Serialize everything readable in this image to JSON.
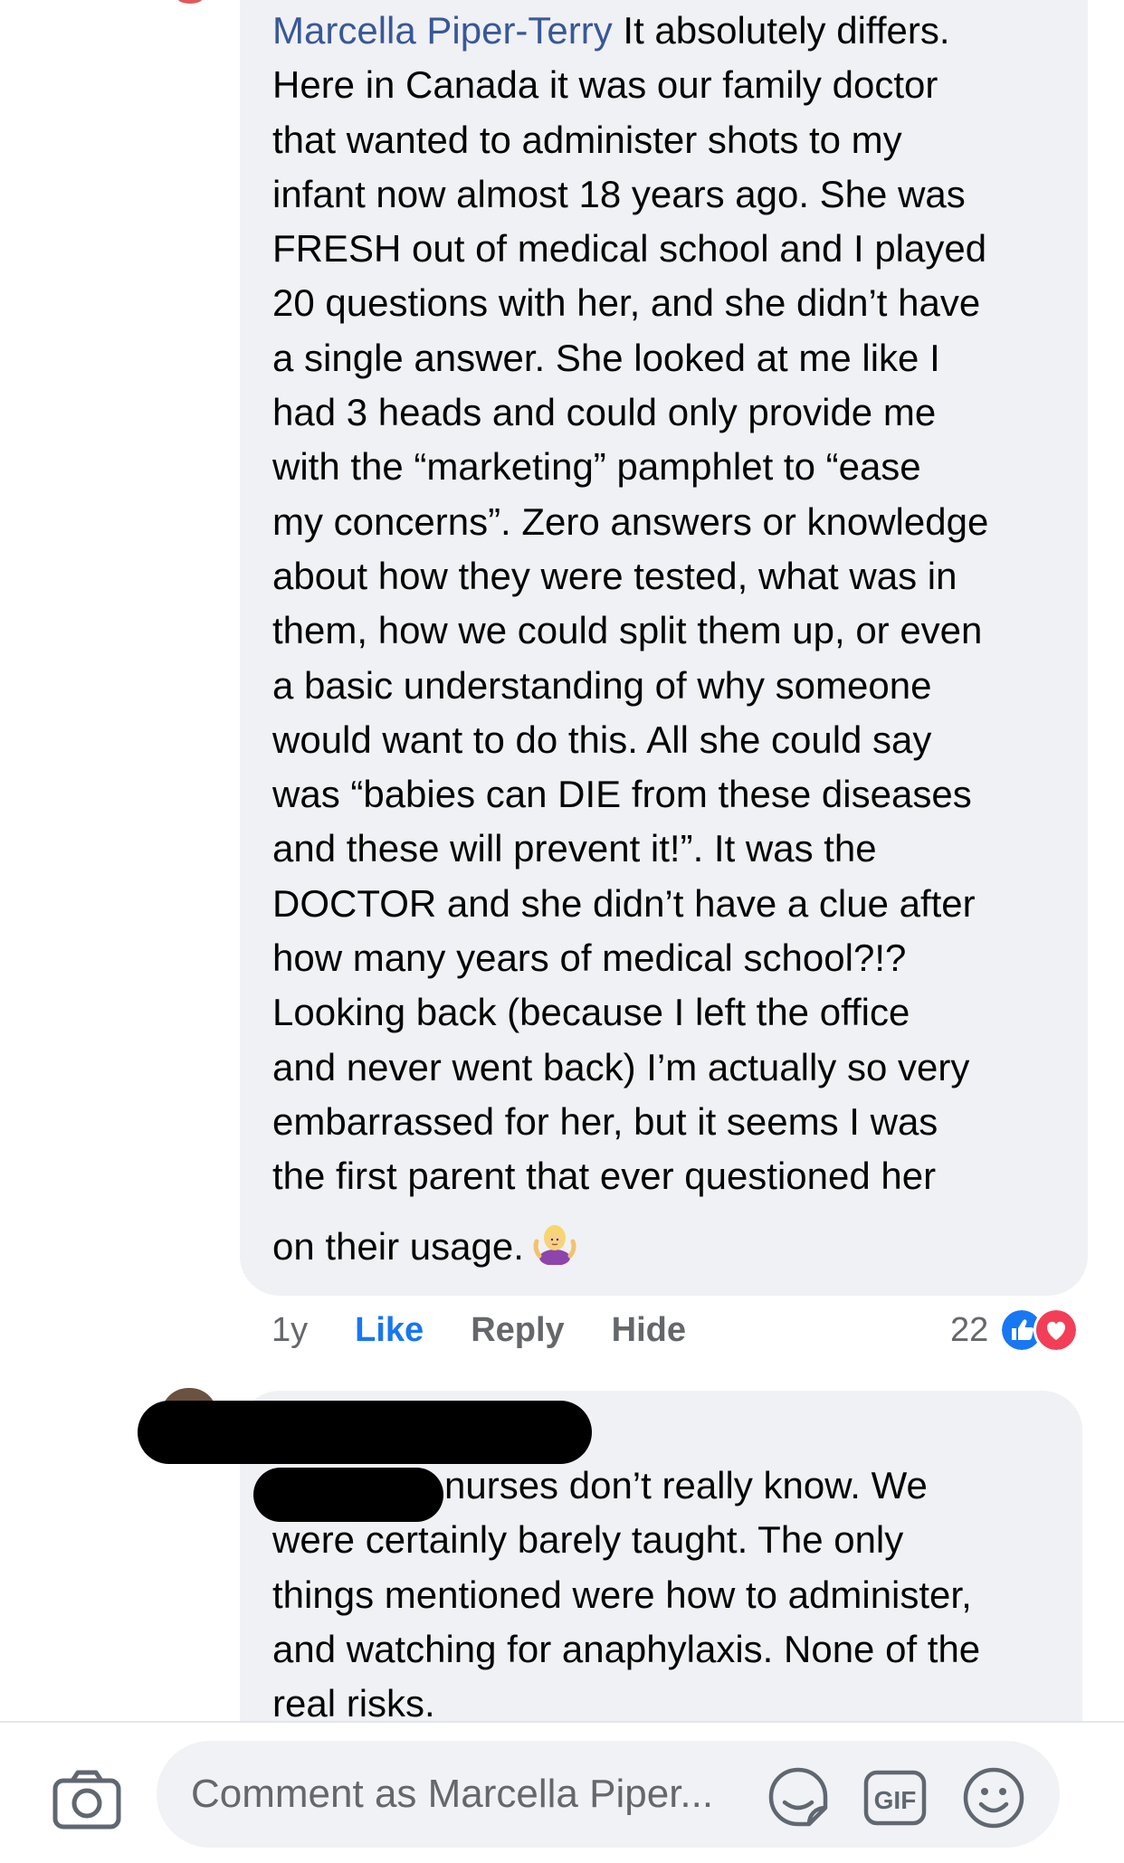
{
  "comment1": {
    "author": "Marcella Piper-Terry",
    "lines": [
      " It absolutely differs.",
      "Here in Canada it was our family doctor",
      "that wanted to administer shots to my",
      "infant now almost 18 years ago. She was",
      "FRESH out of medical school and I played",
      "20 questions with her, and she didn’t have",
      "a single answer. She looked at me like I",
      "had 3 heads and could only provide me",
      "with the “marketing” pamphlet to “ease",
      "my concerns”. Zero answers or knowledge",
      "about how they were tested, what was in",
      "them, how we could split them up, or even",
      "a basic understanding of why someone",
      "would want to do this. All she could say",
      "was “babies can DIE from these diseases",
      "and these will prevent it!”. It was the",
      "DOCTOR and she didn’t have a clue after",
      "how many years of medical school?!?",
      "Looking back (because I left the office",
      "and never went back) I’m actually so very",
      "embarrassed for her, but it seems I was",
      "the first parent that ever questioned her",
      "on their usage."
    ],
    "emoji": "person-shrugging-emoji",
    "time": "1y",
    "like_label": "Like",
    "reply_label": "Reply",
    "hide_label": "Hide",
    "reaction_count": "22",
    "reaction_icons": [
      "like-reaction-icon",
      "love-reaction-icon"
    ]
  },
  "comment2": {
    "lines": [
      "nurses don’t really know. We",
      "were certainly barely taught. The only",
      "things mentioned were how to administer,",
      "and watching for anaphylaxis. None of the",
      "real risks."
    ]
  },
  "composer": {
    "placeholder": "Comment as Marcella Piper...",
    "icons": [
      "camera-icon",
      "sticker-icon",
      "gif-icon",
      "emoji-icon"
    ]
  },
  "colors": {
    "bubble": "#f0f1f4",
    "author": "#385898",
    "like_active": "#1877f2",
    "meta": "#65676b",
    "love": "#f33e58"
  }
}
